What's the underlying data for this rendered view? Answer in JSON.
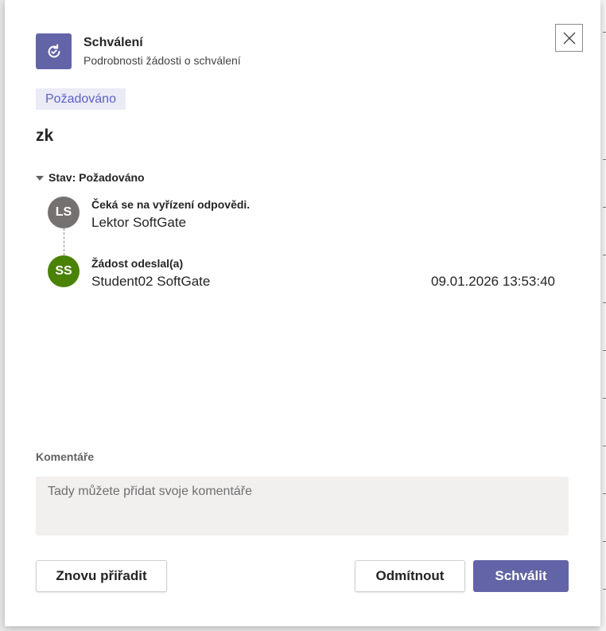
{
  "header": {
    "title": "Schválení",
    "subtitle": "Podrobnosti žádosti o schválení"
  },
  "status_pill": "Požadováno",
  "request_title": "zk",
  "section": {
    "label": "Stav: Požadováno"
  },
  "timeline": [
    {
      "initials": "LS",
      "label": "Čeká se na vyřízení odpovědi.",
      "name": "Lektor SoftGate",
      "date": "",
      "avatar_color": "#757170"
    },
    {
      "initials": "SS",
      "label": "Žádost odeslal(a)",
      "name": "Student02 SoftGate",
      "date": "09.01.2026 13:53:40",
      "avatar_color": "#498205"
    }
  ],
  "comments": {
    "label": "Komentáře",
    "placeholder": "Tady můžete přidat svoje komentáře",
    "value": ""
  },
  "actions": {
    "reassign": "Znovu přiřadit",
    "reject": "Odmítnout",
    "approve": "Schválit"
  },
  "colors": {
    "brand": "#6264a7",
    "pill_bg": "#ebebf6",
    "pill_text": "#5b5fc7"
  },
  "icons": {
    "app": "approvals-refresh-icon",
    "close": "close-icon",
    "collapse": "caret-down-icon"
  }
}
